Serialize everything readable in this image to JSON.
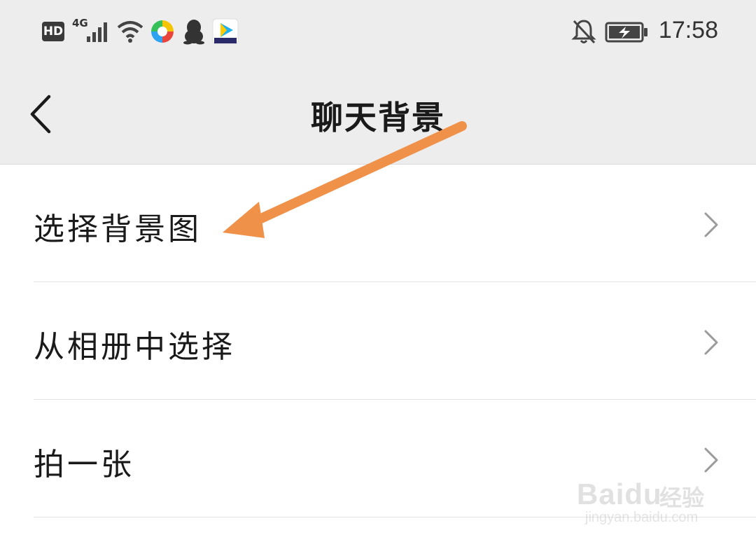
{
  "status_bar": {
    "hd": "HD",
    "network": "4G",
    "time": "17:58",
    "icons": [
      "hd-icon",
      "signal-icon",
      "wifi-icon",
      "colorful-app-icon",
      "qq-penguin-icon",
      "video-app-icon",
      "bell-off-icon",
      "battery-charging-icon"
    ]
  },
  "nav": {
    "back_icon": "chevron-left-icon",
    "title": "聊天背景"
  },
  "menu": {
    "items": [
      {
        "label": "选择背景图",
        "icon": "chevron-right-icon"
      },
      {
        "label": "从相册中选择",
        "icon": "chevron-right-icon"
      },
      {
        "label": "拍一张",
        "icon": "chevron-right-icon"
      }
    ]
  },
  "annotation": {
    "arrow_color": "#f0914a"
  },
  "watermark": {
    "brand": "Baidu",
    "cn": "经验",
    "url": "jingyan.baidu.com"
  },
  "colors": {
    "header_bg": "#ededed",
    "list_bg": "#ffffff",
    "divider": "#e3e3e3",
    "chevron": "#9b9b9b"
  }
}
